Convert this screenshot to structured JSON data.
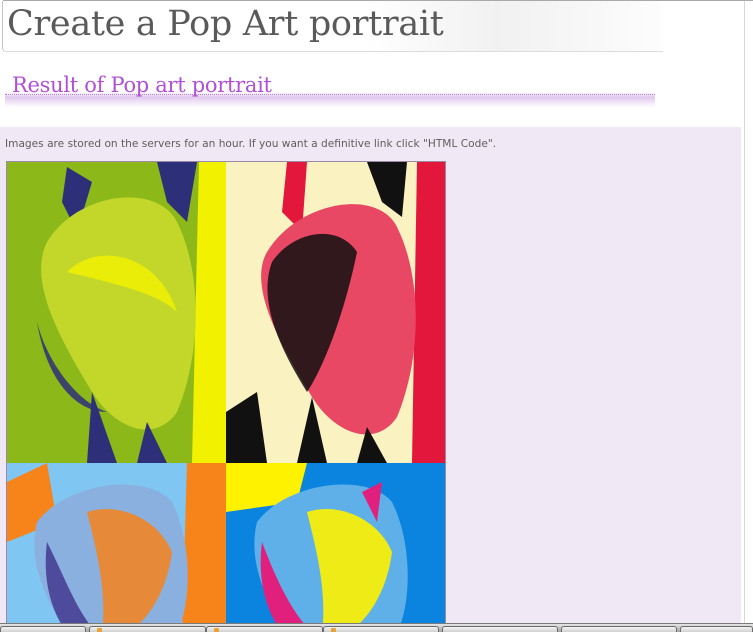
{
  "header": {
    "title": "Create a Pop Art portrait"
  },
  "result": {
    "subtitle": "Result of Pop art portrait",
    "notice": "Images are stored on the servers for an hour. If you want a definitive link click \"HTML Code\"."
  },
  "image": {
    "icon": "pop-art-image",
    "panels": [
      {
        "position": "top-left",
        "background": "#8cb81a",
        "accent": "#f2f200",
        "shadow": "#2e2f79",
        "figure": "#c2d72a"
      },
      {
        "position": "top-right",
        "background": "#fbf2c2",
        "accent": "#e3173b",
        "shadow": "#111111",
        "figure": "#e84863"
      },
      {
        "position": "bottom-left",
        "background": "#f6841b",
        "accent": "#80c6f2",
        "shadow": "#4e4b9c",
        "figure": "#8ab0e0"
      },
      {
        "position": "bottom-right",
        "background": "#0b84e0",
        "accent": "#fff200",
        "shadow": "#e0207c",
        "figure": "#5fb0e8"
      }
    ]
  },
  "taskbar": {
    "items": [
      {
        "id": "t1",
        "label": ""
      },
      {
        "id": "t2",
        "label": ""
      },
      {
        "id": "t3",
        "label": ""
      },
      {
        "id": "t4",
        "label": ""
      },
      {
        "id": "t5",
        "label": ""
      },
      {
        "id": "t6",
        "label": ""
      },
      {
        "id": "t7",
        "label": ""
      }
    ]
  },
  "colors": {
    "title": "#5a5a5a",
    "subtitle": "#b14fd6",
    "content_bg": "#f0e8f4",
    "notice": "#5e5e5e"
  }
}
